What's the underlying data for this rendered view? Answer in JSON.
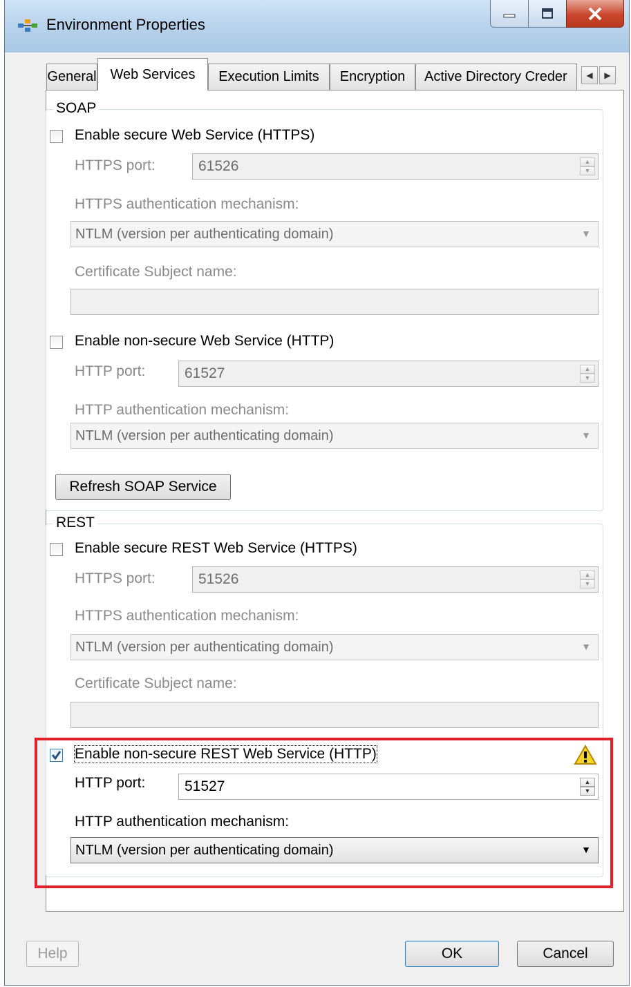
{
  "window": {
    "title": "Environment Properties",
    "controls": [
      "minimize-icon",
      "maximize-icon",
      "close-icon"
    ]
  },
  "tabs": [
    {
      "label": "General",
      "active": false
    },
    {
      "label": "Web Services",
      "active": true
    },
    {
      "label": "Execution Limits",
      "active": false
    },
    {
      "label": "Encryption",
      "active": false
    },
    {
      "label": "Active Directory Creder",
      "active": false
    }
  ],
  "soap": {
    "group_title": "SOAP",
    "https_checkbox": {
      "label": "Enable secure Web Service (HTTPS)",
      "checked": false
    },
    "https_port": {
      "label": "HTTPS port:",
      "value": "61526"
    },
    "https_auth": {
      "label": "HTTPS authentication mechanism:",
      "value": "NTLM (version per authenticating domain)"
    },
    "cert_subject": {
      "label": "Certificate Subject name:",
      "value": ""
    },
    "http_checkbox": {
      "label": "Enable non-secure Web Service (HTTP)",
      "checked": false
    },
    "http_port": {
      "label": "HTTP port:",
      "value": "61527"
    },
    "http_auth": {
      "label": "HTTP authentication mechanism:",
      "value": "NTLM (version per authenticating domain)"
    },
    "refresh_button": "Refresh SOAP Service"
  },
  "rest": {
    "group_title": "REST",
    "https_checkbox": {
      "label": "Enable secure REST Web Service (HTTPS)",
      "checked": false
    },
    "https_port": {
      "label": "HTTPS port:",
      "value": "51526"
    },
    "https_auth": {
      "label": "HTTPS authentication mechanism:",
      "value": "NTLM (version per authenticating domain)"
    },
    "cert_subject": {
      "label": "Certificate Subject name:",
      "value": ""
    },
    "http_checkbox": {
      "label": "Enable non-secure REST Web Service (HTTP)",
      "checked": true
    },
    "http_port": {
      "label": "HTTP port:",
      "value": "51527"
    },
    "http_auth": {
      "label": "HTTP authentication mechanism:",
      "value": "NTLM (version per authenticating domain)"
    },
    "warning_icon": "warning-icon"
  },
  "footer": {
    "help": "Help",
    "ok": "OK",
    "cancel": "Cancel"
  },
  "colors": {
    "highlight": "#e0202a",
    "title_gradient": "#b9d3ec",
    "close_button": "#c9462c"
  }
}
